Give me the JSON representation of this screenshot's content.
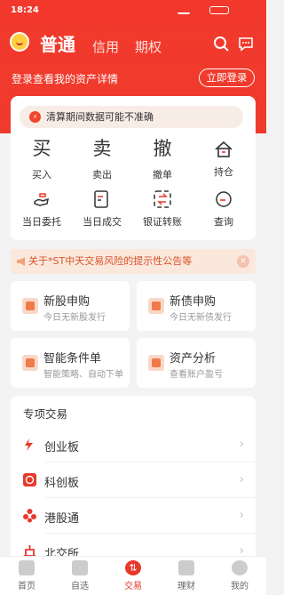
{
  "status": {
    "time": "18:24"
  },
  "header": {
    "tabs": [
      "普通",
      "信用",
      "期权"
    ],
    "login_prompt": "登录查看我的资产详情",
    "login_button": "立即登录"
  },
  "notice": "清算期间数据可能不准确",
  "grid": [
    {
      "label": "买入",
      "glyph": "买"
    },
    {
      "label": "卖出",
      "glyph": "卖"
    },
    {
      "label": "撤单",
      "glyph": "撤"
    },
    {
      "label": "持仓",
      "glyph": "house-icon"
    },
    {
      "label": "当日委托",
      "glyph": "hand-icon"
    },
    {
      "label": "当日成交",
      "glyph": "doc-edit-icon"
    },
    {
      "label": "银证转账",
      "glyph": "transfer-icon"
    },
    {
      "label": "查询",
      "glyph": "search-icon"
    }
  ],
  "banner": "关于*ST中天交易风险的提示性公告等",
  "mini_cards": [
    {
      "title": "新股申购",
      "sub": "今日无新股发行"
    },
    {
      "title": "新债申购",
      "sub": "今日无新债发行"
    },
    {
      "title": "智能条件单",
      "sub": "智能策略、自动下单"
    },
    {
      "title": "资产分析",
      "sub": "查看账户盈亏"
    }
  ],
  "special": {
    "title": "专项交易",
    "rows": [
      "创业板",
      "科创板",
      "港股通",
      "北交所"
    ]
  },
  "nav": [
    "首页",
    "自选",
    "交易",
    "理财",
    "我的"
  ],
  "colors": {
    "brand": "#ee3b2d",
    "accent_bg": "#fbe8dc"
  }
}
